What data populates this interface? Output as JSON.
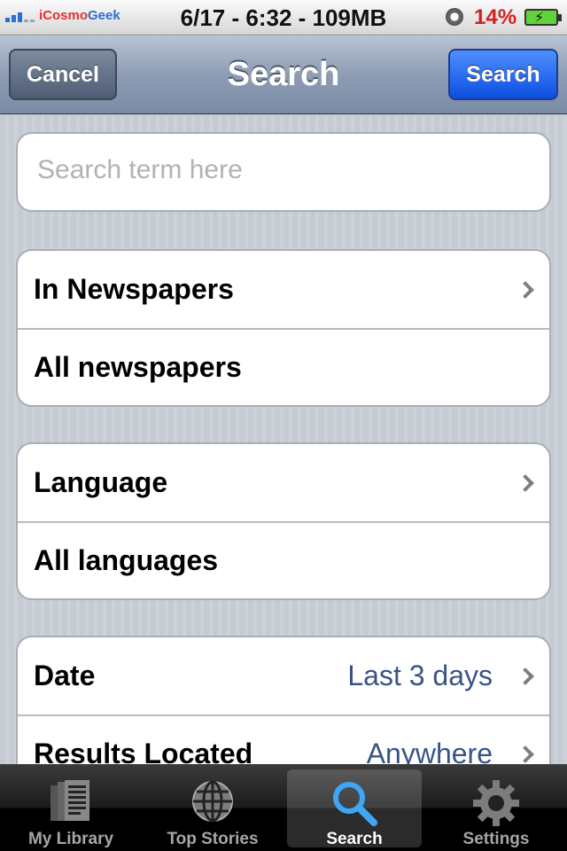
{
  "status_bar": {
    "carrier_prefix": "iCosmo",
    "carrier_suffix": "Geek",
    "center_text": "6/17 - 6:32 - 109MB",
    "battery_percent": "14%",
    "battery_charging": true
  },
  "nav": {
    "title": "Search",
    "left_button": "Cancel",
    "right_button": "Search"
  },
  "search": {
    "placeholder": "Search term here",
    "value": ""
  },
  "groups": [
    {
      "rows": [
        {
          "label": "In Newspapers",
          "value": "",
          "chevron": true
        },
        {
          "label": "All newspapers",
          "value": "",
          "chevron": false
        }
      ]
    },
    {
      "rows": [
        {
          "label": "Language",
          "value": "",
          "chevron": true
        },
        {
          "label": "All languages",
          "value": "",
          "chevron": false
        }
      ]
    },
    {
      "rows": [
        {
          "label": "Date",
          "value": "Last 3 days",
          "chevron": true
        },
        {
          "label": "Results Located",
          "value": "Anywhere",
          "chevron": true
        }
      ]
    }
  ],
  "tabs": [
    {
      "label": "My Library",
      "icon": "newspaper-icon",
      "active": false
    },
    {
      "label": "Top Stories",
      "icon": "globe-icon",
      "active": false
    },
    {
      "label": "Search",
      "icon": "magnifier-icon",
      "active": true
    },
    {
      "label": "Settings",
      "icon": "gear-icon",
      "active": false
    }
  ],
  "colors": {
    "accent_blue": "#1a62ef",
    "value_blue": "#385487",
    "battery_red": "#d42020"
  }
}
